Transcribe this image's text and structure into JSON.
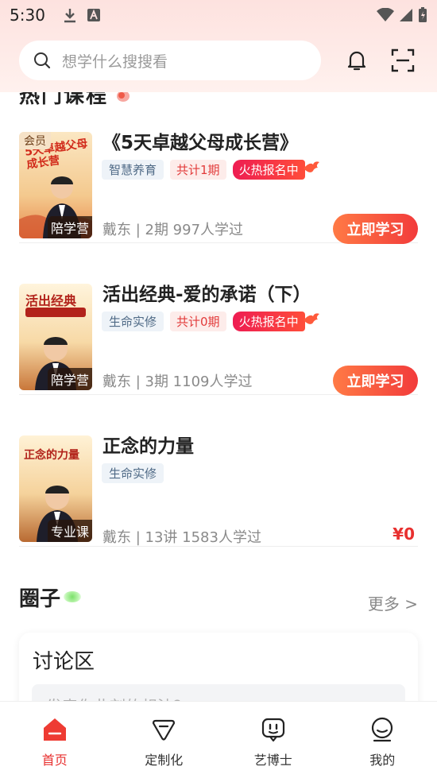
{
  "status_bar": {
    "time": "5:30"
  },
  "search": {
    "placeholder": "想学什么搜搜看"
  },
  "section_title": "热门课程",
  "courses": [
    {
      "title": "《5天卓越父母成长营》",
      "category": "智慧养育",
      "count": "共计1期",
      "hot_label": "火热报名中",
      "cover_tag": "陪学营",
      "vip_tag": "会员",
      "cover_text": "5天卓越父母成长营",
      "meta": "戴东 | 2期  997人学过",
      "action": "立即学习"
    },
    {
      "title": "活出经典-爱的承诺（下）",
      "category": "生命实修",
      "count": "共计0期",
      "hot_label": "火热报名中",
      "cover_tag": "陪学营",
      "cover_text": "活出经典",
      "meta": "戴东 | 3期  1109人学过",
      "action": "立即学习"
    },
    {
      "title": "正念的力量",
      "category": "生命实修",
      "cover_tag": "专业课",
      "cover_text": "正念的力量",
      "meta": "戴东 | 13讲  1583人学过",
      "price": "¥0"
    }
  ],
  "circle": {
    "title": "圈子",
    "more": "更多 >",
    "card_title": "讨论区",
    "input_placeholder": "发表你此刻的想法？"
  },
  "nav": [
    {
      "label": "首页",
      "icon": "home-icon",
      "active": true
    },
    {
      "label": "定制化",
      "icon": "diamond-icon"
    },
    {
      "label": "艺博士",
      "icon": "robot-icon"
    },
    {
      "label": "我的",
      "icon": "profile-icon"
    }
  ],
  "colors": {
    "accent": "#e8302f",
    "header_bg": "#fde2df"
  }
}
